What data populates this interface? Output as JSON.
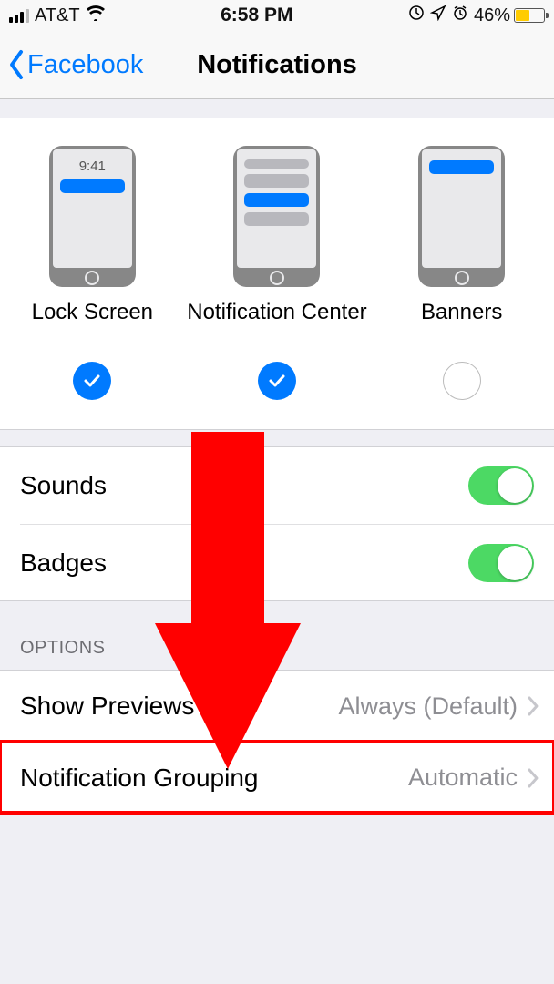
{
  "status_bar": {
    "carrier": "AT&T",
    "time": "6:58 PM",
    "battery_pct": "46%"
  },
  "nav": {
    "back_label": "Facebook",
    "title": "Notifications"
  },
  "alerts": {
    "lock_screen": {
      "label": "Lock Screen",
      "mock_time": "9:41",
      "checked": true
    },
    "notification_center": {
      "label": "Notification Center",
      "checked": true
    },
    "banners": {
      "label": "Banners",
      "checked": false
    }
  },
  "toggles": {
    "sounds": {
      "label": "Sounds",
      "on": true
    },
    "badges": {
      "label": "Badges",
      "on": true
    }
  },
  "options": {
    "header": "OPTIONS",
    "show_previews": {
      "label": "Show Previews",
      "value": "Always (Default)"
    },
    "notification_grouping": {
      "label": "Notification Grouping",
      "value": "Automatic"
    }
  }
}
